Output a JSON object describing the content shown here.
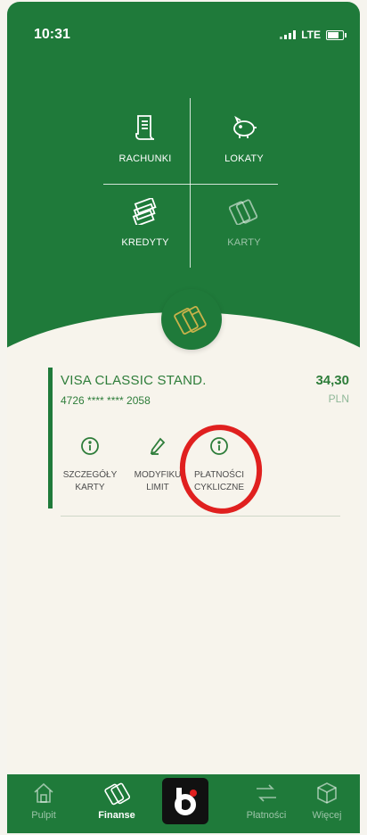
{
  "status_bar": {
    "time": "10:31",
    "network": "LTE"
  },
  "menu": {
    "items": [
      {
        "label": "RACHUNKI",
        "icon": "document-icon",
        "disabled": false
      },
      {
        "label": "LOKATY",
        "icon": "piggy-bank-icon",
        "disabled": false
      },
      {
        "label": "KREDYTY",
        "icon": "cash-stack-icon",
        "disabled": false
      },
      {
        "label": "KARTY",
        "icon": "cards-icon",
        "disabled": true
      }
    ]
  },
  "card": {
    "title": "VISA CLASSIC STAND.",
    "number": "4726 **** **** 2058",
    "amount": "34,30",
    "currency": "PLN",
    "actions": [
      {
        "line1": "SZCZEGÓŁY",
        "line2": "KARTY",
        "icon": "info-icon"
      },
      {
        "line1": "MODYFIKU",
        "line2": "LIMIT",
        "icon": "pencil-icon"
      },
      {
        "line1": "PŁATNOŚCI",
        "line2": "CYKLICZNE",
        "icon": "info-icon"
      }
    ]
  },
  "tabbar": {
    "tabs": [
      {
        "label": "Pulpit",
        "icon": "home-icon",
        "active": false
      },
      {
        "label": "Finanse",
        "icon": "wallet-icon",
        "active": true
      },
      {
        "label": "",
        "icon": "bank-logo-icon",
        "active": false
      },
      {
        "label": "Płatności",
        "icon": "transfer-arrows-icon",
        "active": false
      },
      {
        "label": "Więcej",
        "icon": "box-icon",
        "active": false
      }
    ]
  },
  "colors": {
    "primary_green": "#1f7a3a",
    "background": "#f7f4ec",
    "annotation_red": "#e0201f"
  }
}
